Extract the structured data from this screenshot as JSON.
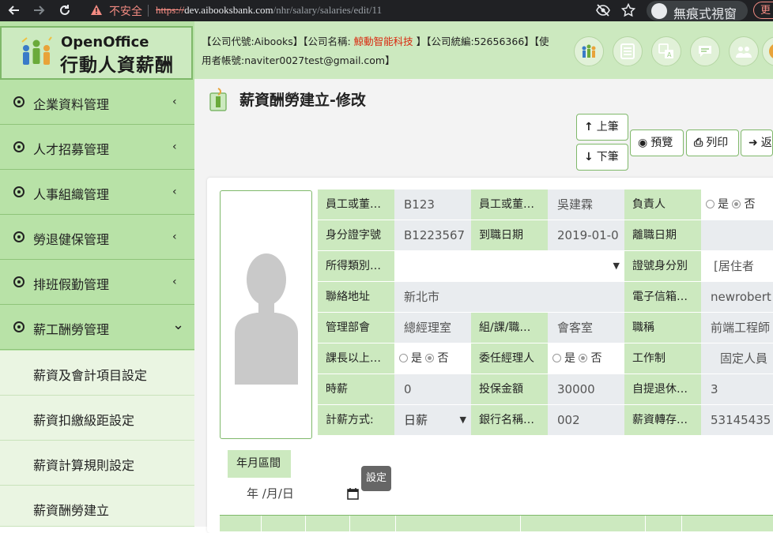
{
  "browser": {
    "insecure_label": "不安全",
    "url_protocol": "https://",
    "url_host": "dev.aibooksbank.com",
    "url_path": "/nhr/salary/salaries/edit/11",
    "incognito_label": "無痕式視窗",
    "update_label": "更"
  },
  "logo": {
    "brand_en": "OpenOffice",
    "brand_zh": "行動人資薪酬"
  },
  "sidebar": {
    "items": [
      {
        "label": "企業資料管理",
        "chevron": "‹"
      },
      {
        "label": "人才招募管理",
        "chevron": "‹"
      },
      {
        "label": "人事組織管理",
        "chevron": "‹"
      },
      {
        "label": "勞退健保管理",
        "chevron": "‹"
      },
      {
        "label": "排班假勤管理",
        "chevron": "‹"
      },
      {
        "label": "薪工酬勞管理",
        "chevron": "⌄"
      }
    ],
    "subitems": [
      {
        "label": "薪資及會計項目設定"
      },
      {
        "label": "薪資扣繳級距設定"
      },
      {
        "label": "薪資計算規則設定"
      },
      {
        "label": "薪資酬勞建立"
      }
    ]
  },
  "topbar": {
    "company_code": "【公司代號:Aibooks】",
    "company_name_prefix": "【公司名稱:",
    "company_name": "鯨動智能科技",
    "company_name_suffix": "】",
    "company_taxid": "【公司統編:52656366】",
    "user_prefix": "【使",
    "user_account": "用者帳號:naviter0027test@gmail.com】"
  },
  "page": {
    "title": "薪資酬勞建立-修改",
    "buttons": {
      "prev": "上筆",
      "next": "下筆",
      "preview": "預覽",
      "print": "列印",
      "back": "返"
    }
  },
  "form": {
    "rows": [
      [
        {
          "label": "員工或董…",
          "value": "B123"
        },
        {
          "label": "員工或董…",
          "value": "吳建霖"
        },
        {
          "label": "負責人",
          "radio": [
            "是",
            "否"
          ],
          "selected": "否"
        }
      ],
      [
        {
          "label": "身分證字號",
          "value": "B1223567"
        },
        {
          "label": "到職日期",
          "value": "2019-01-0"
        },
        {
          "label": "離職日期",
          "value": ""
        }
      ],
      [
        {
          "label": "所得類別…",
          "value": ""
        },
        {
          "label": "證號身分別",
          "value": "[居住者"
        }
      ],
      [
        {
          "label": "聯絡地址",
          "value": "新北市"
        },
        {
          "label": "電子信箱…",
          "value": "newrobert"
        }
      ],
      [
        {
          "label": "管理部會",
          "value": "總經理室"
        },
        {
          "label": "組/課/職…",
          "value": "會客室"
        },
        {
          "label": "職稱",
          "value": "前端工程師"
        }
      ],
      [
        {
          "label": "課長以上…",
          "radio": [
            "是",
            "否"
          ],
          "selected": "否"
        },
        {
          "label": "委任經理人",
          "radio": [
            "是",
            "否"
          ],
          "selected": "否"
        },
        {
          "label": "工作制",
          "value": "固定人員"
        }
      ],
      [
        {
          "label": "時薪",
          "value": "0"
        },
        {
          "label": "投保金額",
          "value": "30000"
        },
        {
          "label": "自提退休…",
          "value": "3"
        }
      ],
      [
        {
          "label": "計薪方式:",
          "value": "日薪"
        },
        {
          "label": "銀行名稱…",
          "value": "002"
        },
        {
          "label": "薪資轉存…",
          "value": "53145435"
        }
      ]
    ]
  },
  "period": {
    "label": "年月區間",
    "date_placeholder": "年 /月/日",
    "tooltip": "設定"
  },
  "colors": {
    "sidebar": "#b8e2a7",
    "label_bg": "#cce9bf",
    "accent_border": "#7fb86a",
    "company_name": "#d9290f"
  }
}
